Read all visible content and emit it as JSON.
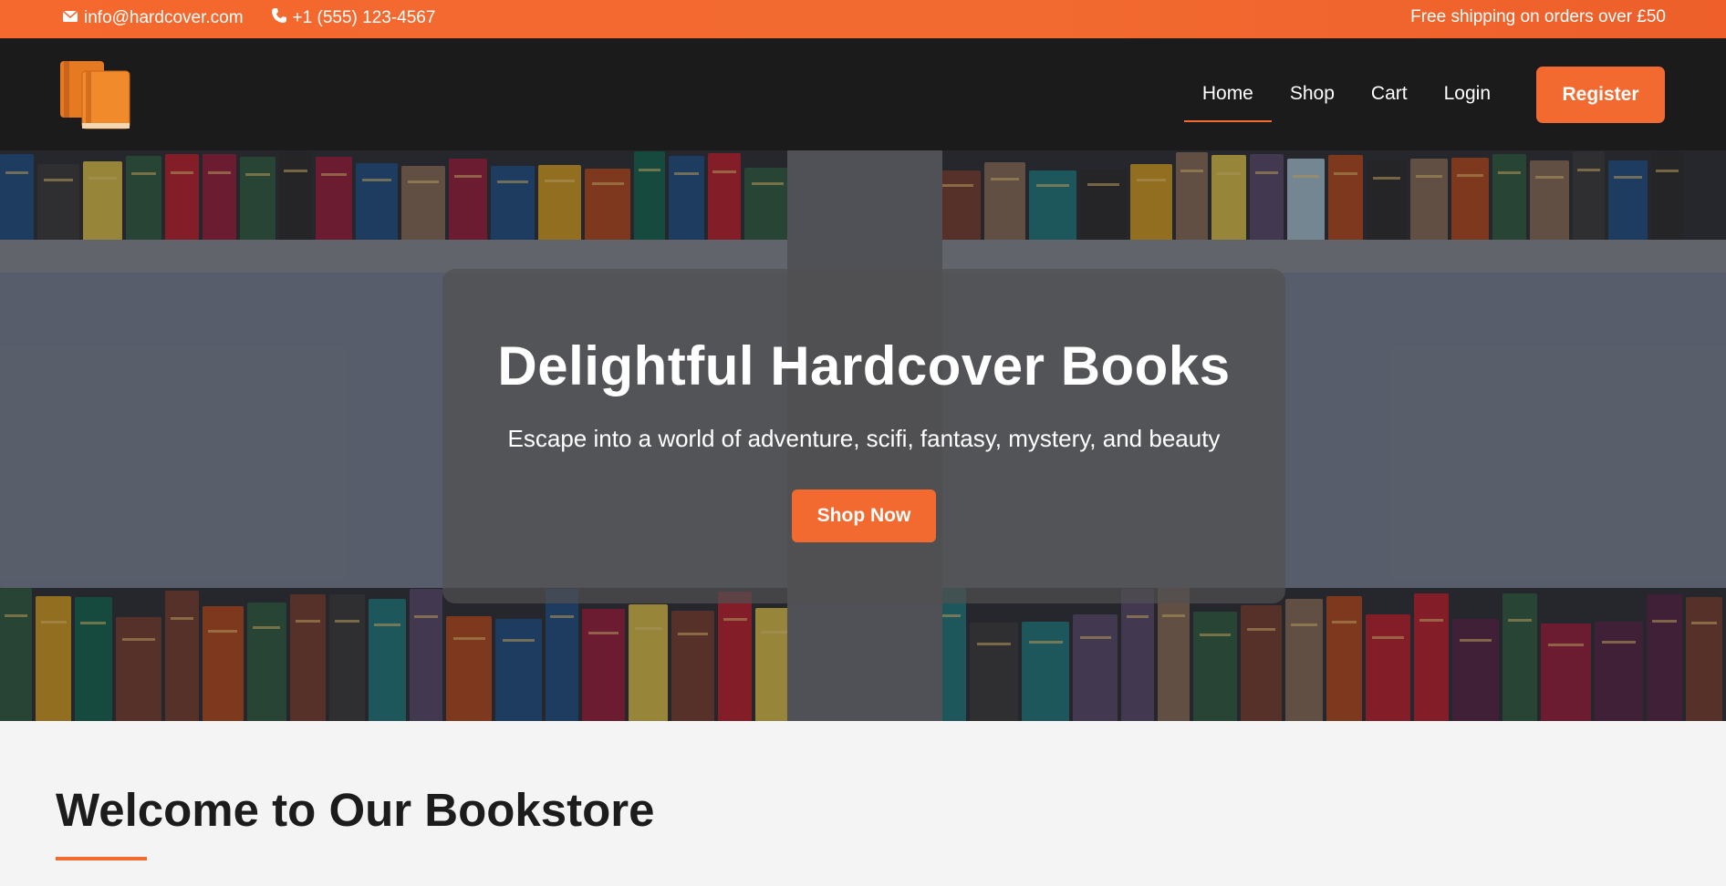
{
  "topbar": {
    "email": "info@hardcover.com",
    "email_icon": "envelope-icon",
    "phone": "+1 (555) 123-4567",
    "phone_icon": "phone-icon",
    "promo": "Free shipping on orders over £50"
  },
  "nav": {
    "logo_icon": "books-logo-icon",
    "links": [
      {
        "label": "Home",
        "active": true
      },
      {
        "label": "Shop",
        "active": false
      },
      {
        "label": "Cart",
        "active": false
      },
      {
        "label": "Login",
        "active": false
      }
    ],
    "register": "Register"
  },
  "hero": {
    "title": "Delightful Hardcover Books",
    "subtitle": "Escape into a world of adventure, scifi, fantasy, mystery, and beauty",
    "cta": "Shop Now"
  },
  "welcome": {
    "title": "Welcome to Our Bookstore"
  },
  "colors": {
    "accent": "#f26a30",
    "nav_bg": "#1b1b1b",
    "page_bg": "#f4f4f4"
  }
}
